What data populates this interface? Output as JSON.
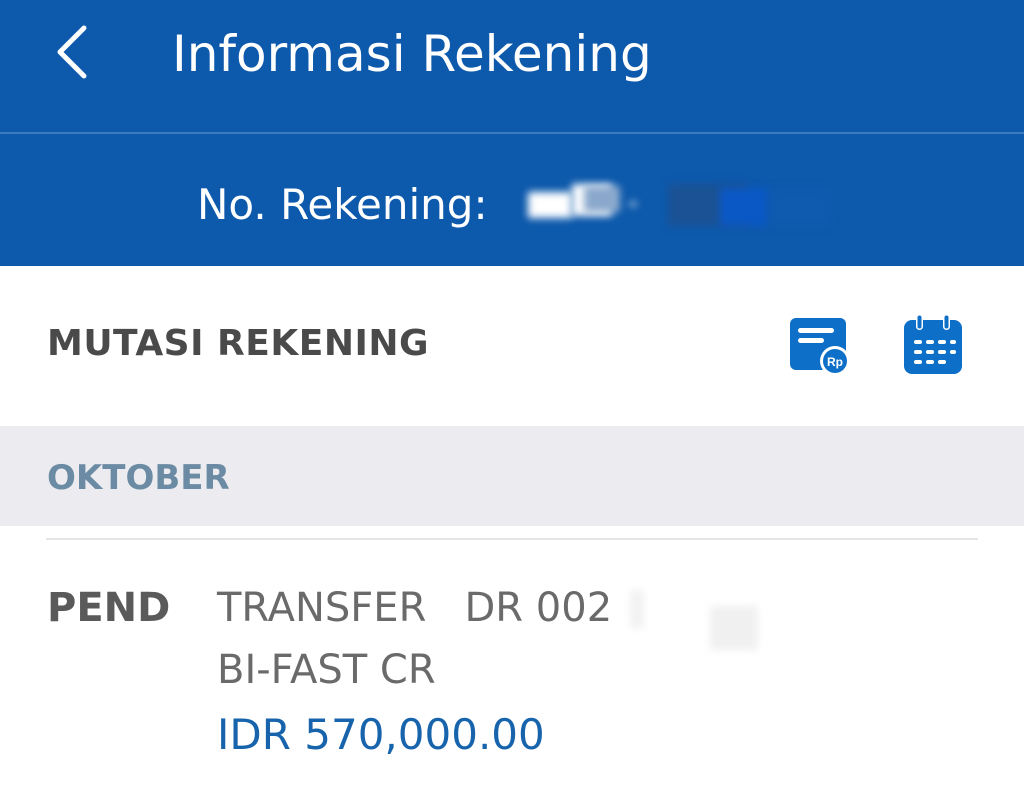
{
  "header": {
    "title": "Informasi Rekening",
    "back_icon": "chevron-left-icon",
    "account_label": "No. Rekening:",
    "account_number_masked": true
  },
  "section": {
    "title": "MUTASI REKENING",
    "icons": [
      "statement-rupiah-icon",
      "calendar-icon"
    ]
  },
  "month": {
    "label": "OKTOBER"
  },
  "transactions": [
    {
      "status": "PEND",
      "description_line1": "TRANSFER   DR 002",
      "description_line2": "BI-FAST CR",
      "amount": "IDR 570,000.00"
    }
  ],
  "colors": {
    "header_bg": "#0d59ac",
    "accent": "#1764ac",
    "month_bar_bg": "#ececf0",
    "month_text": "#6b8aa3"
  }
}
